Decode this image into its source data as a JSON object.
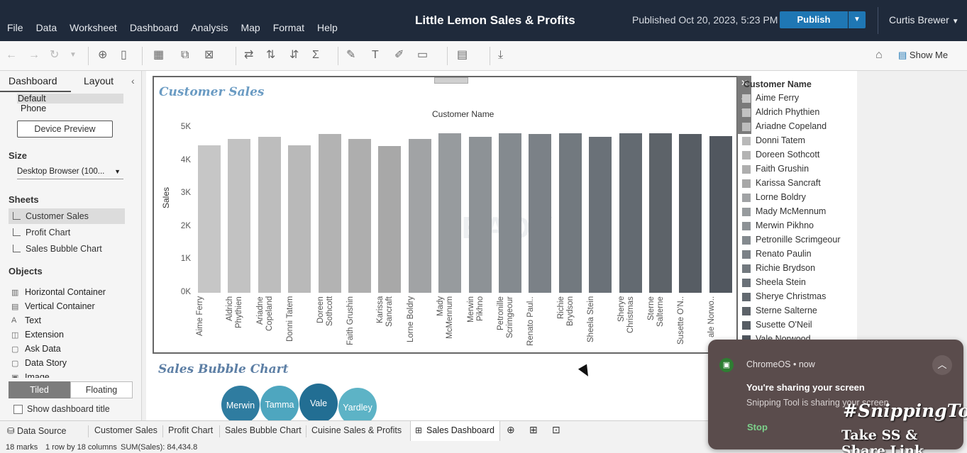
{
  "header": {
    "menu": [
      "File",
      "Data",
      "Worksheet",
      "Dashboard",
      "Analysis",
      "Map",
      "Format",
      "Help"
    ],
    "title": "Little Lemon Sales & Profits",
    "published": "Published Oct 20, 2023, 5:23 PM",
    "publish_label": "Publish",
    "user": "Curtis Brewer"
  },
  "toolbar": {
    "show_me": "Show Me"
  },
  "sidebar": {
    "tab_dashboard": "Dashboard",
    "tab_layout": "Layout",
    "device_default": "Default",
    "device_phone": "Phone",
    "device_preview": "Device Preview",
    "size_heading": "Size",
    "size_value": "Desktop Browser (100...",
    "sheets_heading": "Sheets",
    "sheets": [
      "Customer Sales",
      "Profit Chart",
      "Sales Bubble Chart"
    ],
    "objects_heading": "Objects",
    "objects": [
      "Horizontal Container",
      "Vertical Container",
      "Text",
      "Extension",
      "Ask Data",
      "Data Story",
      "Image"
    ],
    "tiled": "Tiled",
    "floating": "Floating",
    "show_title": "Show dashboard title"
  },
  "worksheet": {
    "title": "Customer Sales",
    "watermark": "READY"
  },
  "chart_data": {
    "type": "bar",
    "title": "Customer Sales",
    "top_label": "Customer Name",
    "ylabel": "Sales",
    "ylim": [
      0,
      5000
    ],
    "yticks": [
      "0K",
      "1K",
      "2K",
      "3K",
      "4K",
      "5K"
    ],
    "categories": [
      "Aime Ferry",
      "Aldrich Phythien",
      "Ariadne Copeland",
      "Donni Tatem",
      "Doreen Sothcott",
      "Faith Grushin",
      "Karissa Sancraft",
      "Lorne Boldry",
      "Mady McMennum",
      "Merwin Pikhno",
      "Petronille Scrimgeour",
      "Renato Paulin",
      "Richie Brydson",
      "Sheela Stein",
      "Sherye Christmas",
      "Sterne Salterne",
      "Susette O'Neil",
      "Vale Norwood"
    ],
    "tick_labels": [
      "Aime Ferry",
      "Aldrich\nPhythien",
      "Ariadne\nCopeland",
      "Donni Tatem",
      "Doreen\nSothcott",
      "Faith Grushin",
      "Karissa\nSancraft",
      "Lorne Boldry",
      "Mady\nMcMennum",
      "Merwin\nPikhno",
      "Petronille\nScrimgeour",
      "Renato Paul..",
      "Richie\nBrydson",
      "Sheela Stein",
      "Sherye\nChristmas",
      "Sterne\nSalterne",
      "Susette O'N..",
      "ale Norwo.."
    ],
    "values": [
      4470,
      4650,
      4720,
      4460,
      4800,
      4650,
      4440,
      4650,
      4820,
      4730,
      4820,
      4800,
      4830,
      4730,
      4820,
      4820,
      4800,
      4750
    ],
    "colors": [
      "#c6c6c6",
      "#c2c2c2",
      "#bdbdbd",
      "#b9b9b9",
      "#b3b3b3",
      "#aeaeae",
      "#a8a8a8",
      "#a1a3a5",
      "#979b9e",
      "#8d9296",
      "#848a8f",
      "#7b8187",
      "#72797f",
      "#6a7178",
      "#636a71",
      "#5d6369",
      "#575d64",
      "#51575f"
    ],
    "grid": false,
    "legend": "right"
  },
  "legend": {
    "title": "Customer Name",
    "items": [
      "Aime Ferry",
      "Aldrich Phythien",
      "Ariadne Copeland",
      "Donni Tatem",
      "Doreen Sothcott",
      "Faith Grushin",
      "Karissa Sancraft",
      "Lorne Boldry",
      "Mady McMennum",
      "Merwin Pikhno",
      "Petronille Scrimgeour",
      "Renato Paulin",
      "Richie Brydson",
      "Sheela Stein",
      "Sherye Christmas",
      "Sterne Salterne",
      "Susette O'Neil",
      "Vale Norwood"
    ]
  },
  "bubble_chart": {
    "title": "Sales Bubble Chart",
    "bubbles": [
      {
        "label": "Merwin",
        "color": "#2f7ca0"
      },
      {
        "label": "Tamma",
        "color": "#4ea6bf"
      },
      {
        "label": "Vale",
        "color": "#226e93"
      },
      {
        "label": "Yardley",
        "color": "#5db3c6"
      }
    ]
  },
  "bottom_tabs": {
    "data_source": "Data Source",
    "tabs": [
      "Customer Sales",
      "Profit Chart",
      "Sales Bubble Chart",
      "Cuisine Sales & Profits"
    ],
    "active": "Sales Dashboard"
  },
  "status": {
    "marks": "18 marks",
    "rows": "1 row by 18 columns",
    "sum": "SUM(Sales): 84,434.8"
  },
  "notification": {
    "app": "ChromeOS",
    "time": "now",
    "title": "You're sharing your screen",
    "body": "Snipping Tool is sharing your screen.",
    "stop": "Stop",
    "overlay1": "#SnippingTool",
    "overlay2": "Take SS & Share Link"
  }
}
